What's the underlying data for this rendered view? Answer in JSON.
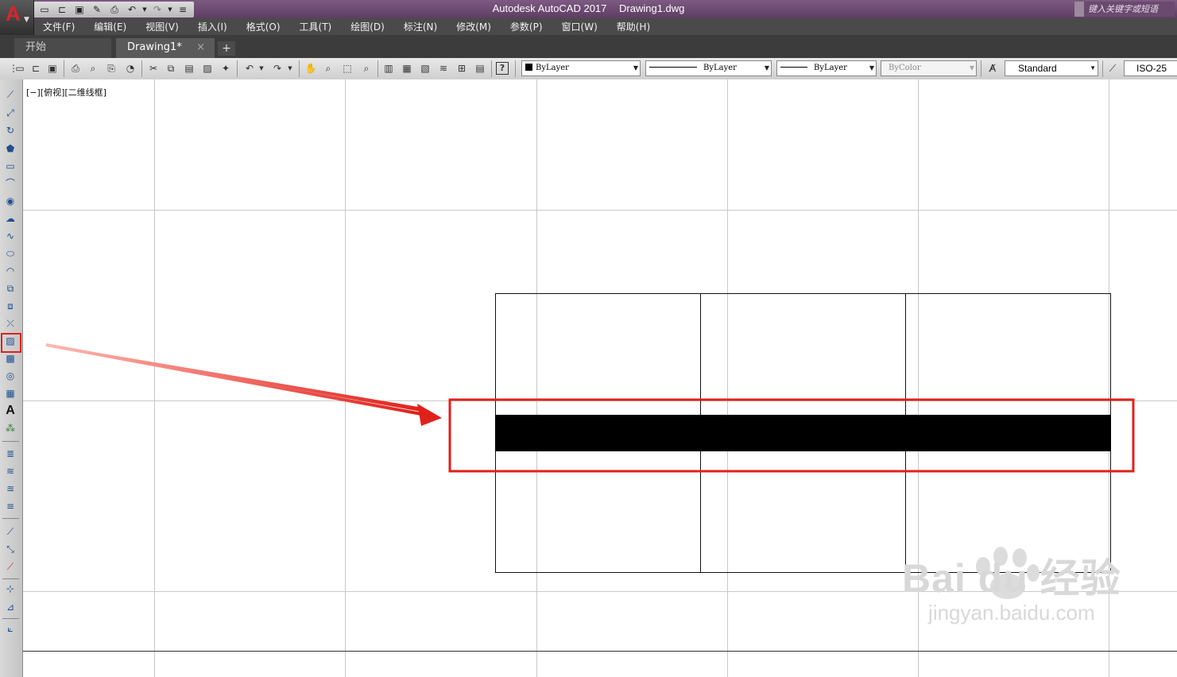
{
  "app": {
    "logo_letter": "A",
    "title": "Autodesk AutoCAD 2017",
    "filename": "Drawing1.dwg",
    "search_placeholder": "键入关键字或短语"
  },
  "quick_access": [
    "new-icon",
    "open-icon",
    "save-icon",
    "saveas-icon",
    "plot-icon",
    "undo-icon",
    "redo-icon",
    "customize-icon"
  ],
  "menu": [
    "文件(F)",
    "编辑(E)",
    "视图(V)",
    "插入(I)",
    "格式(O)",
    "工具(T)",
    "绘图(D)",
    "标注(N)",
    "修改(M)",
    "参数(P)",
    "窗口(W)",
    "帮助(H)"
  ],
  "tabs": {
    "start": "开始",
    "drawing": "Drawing1*",
    "close": "×",
    "add": "+"
  },
  "toolbar": {
    "color_combo": "ByLayer",
    "linetype_combo": "ByLayer",
    "lineweight_combo": "ByLayer",
    "plotstyle_combo": "ByColor",
    "textstyle_combo": "Standard",
    "dimstyle_combo": "ISO-25"
  },
  "left_toolbar_text_tool": "A",
  "viewport_label": "[−][俯视][二维线框]",
  "watermark": {
    "main": "Bai du 经验",
    "sub": "jingyan.baidu.com"
  },
  "colors": {
    "highlight": "#e0211b",
    "title_bar": "#6b4a70",
    "grid": "#c9c9c9"
  }
}
